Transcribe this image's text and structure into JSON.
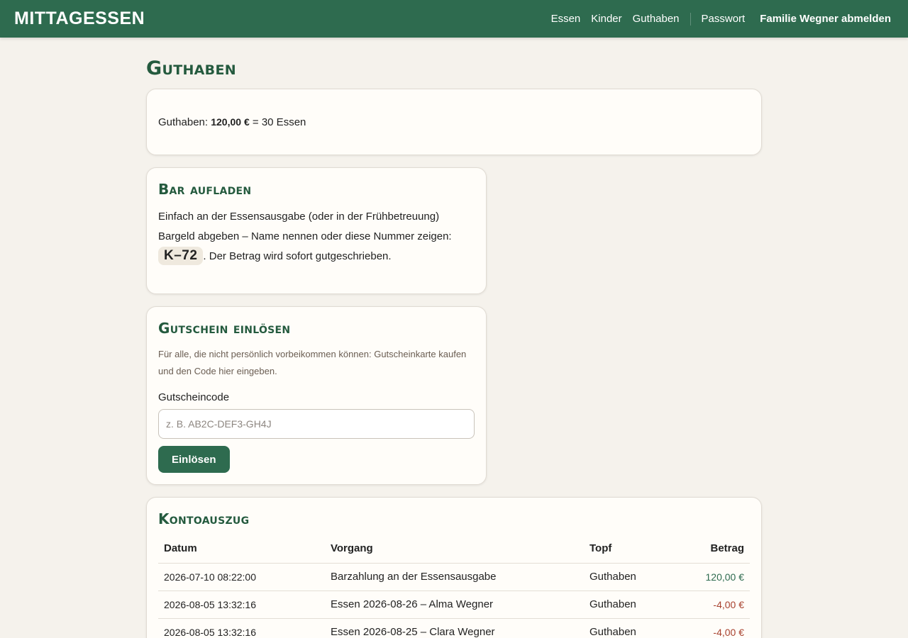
{
  "app": {
    "brand": "Mittagessen"
  },
  "nav": {
    "items": [
      "Essen",
      "Kinder",
      "Guthaben"
    ],
    "password": "Passwort",
    "logout": "Familie Wegner abmelden"
  },
  "page": {
    "title": "Guthaben"
  },
  "balance": {
    "label": "Guthaben:",
    "amount": "120,00 €",
    "equals": "= 30 Essen"
  },
  "cash": {
    "title": "Bar aufladen",
    "text_before": "Einfach an der Essensausgabe (oder in der Frühbetreuung) Bargeld abgeben – Name nennen oder diese Nummer zeigen:",
    "code": "K–72",
    "text_after": ". Der Betrag wird sofort gutgeschrieben."
  },
  "voucher": {
    "title": "Gutschein einlösen",
    "hint": "Für alle, die nicht persönlich vorbeikommen können: Gutscheinkarte kaufen und den Code hier eingeben.",
    "field_label": "Gutscheincode",
    "placeholder": "z. B. AB2C-DEF3-GH4J",
    "value": "",
    "button": "Einlösen"
  },
  "statement": {
    "title": "Kontoauszug",
    "columns": [
      "Datum",
      "Vorgang",
      "Topf",
      "Betrag"
    ],
    "rows": [
      {
        "date": "2026-07-10 08:22:00",
        "desc": "Barzahlung an der Essensausgabe",
        "pot": "Guthaben",
        "amount": "120,00 €",
        "sign": "pos"
      },
      {
        "date": "2026-08-05 13:32:16",
        "desc": "Essen 2026-08-26 – Alma Wegner",
        "pot": "Guthaben",
        "amount": "-4,00 €",
        "sign": "neg"
      },
      {
        "date": "2026-08-05 13:32:16",
        "desc": "Essen 2026-08-25 – Clara Wegner",
        "pot": "Guthaben",
        "amount": "-4,00 €",
        "sign": "neg"
      }
    ]
  },
  "colors": {
    "accent": "#2e6b4f",
    "heading": "#245a3e",
    "negative": "#a8422f",
    "background": "#f5f2ec"
  }
}
